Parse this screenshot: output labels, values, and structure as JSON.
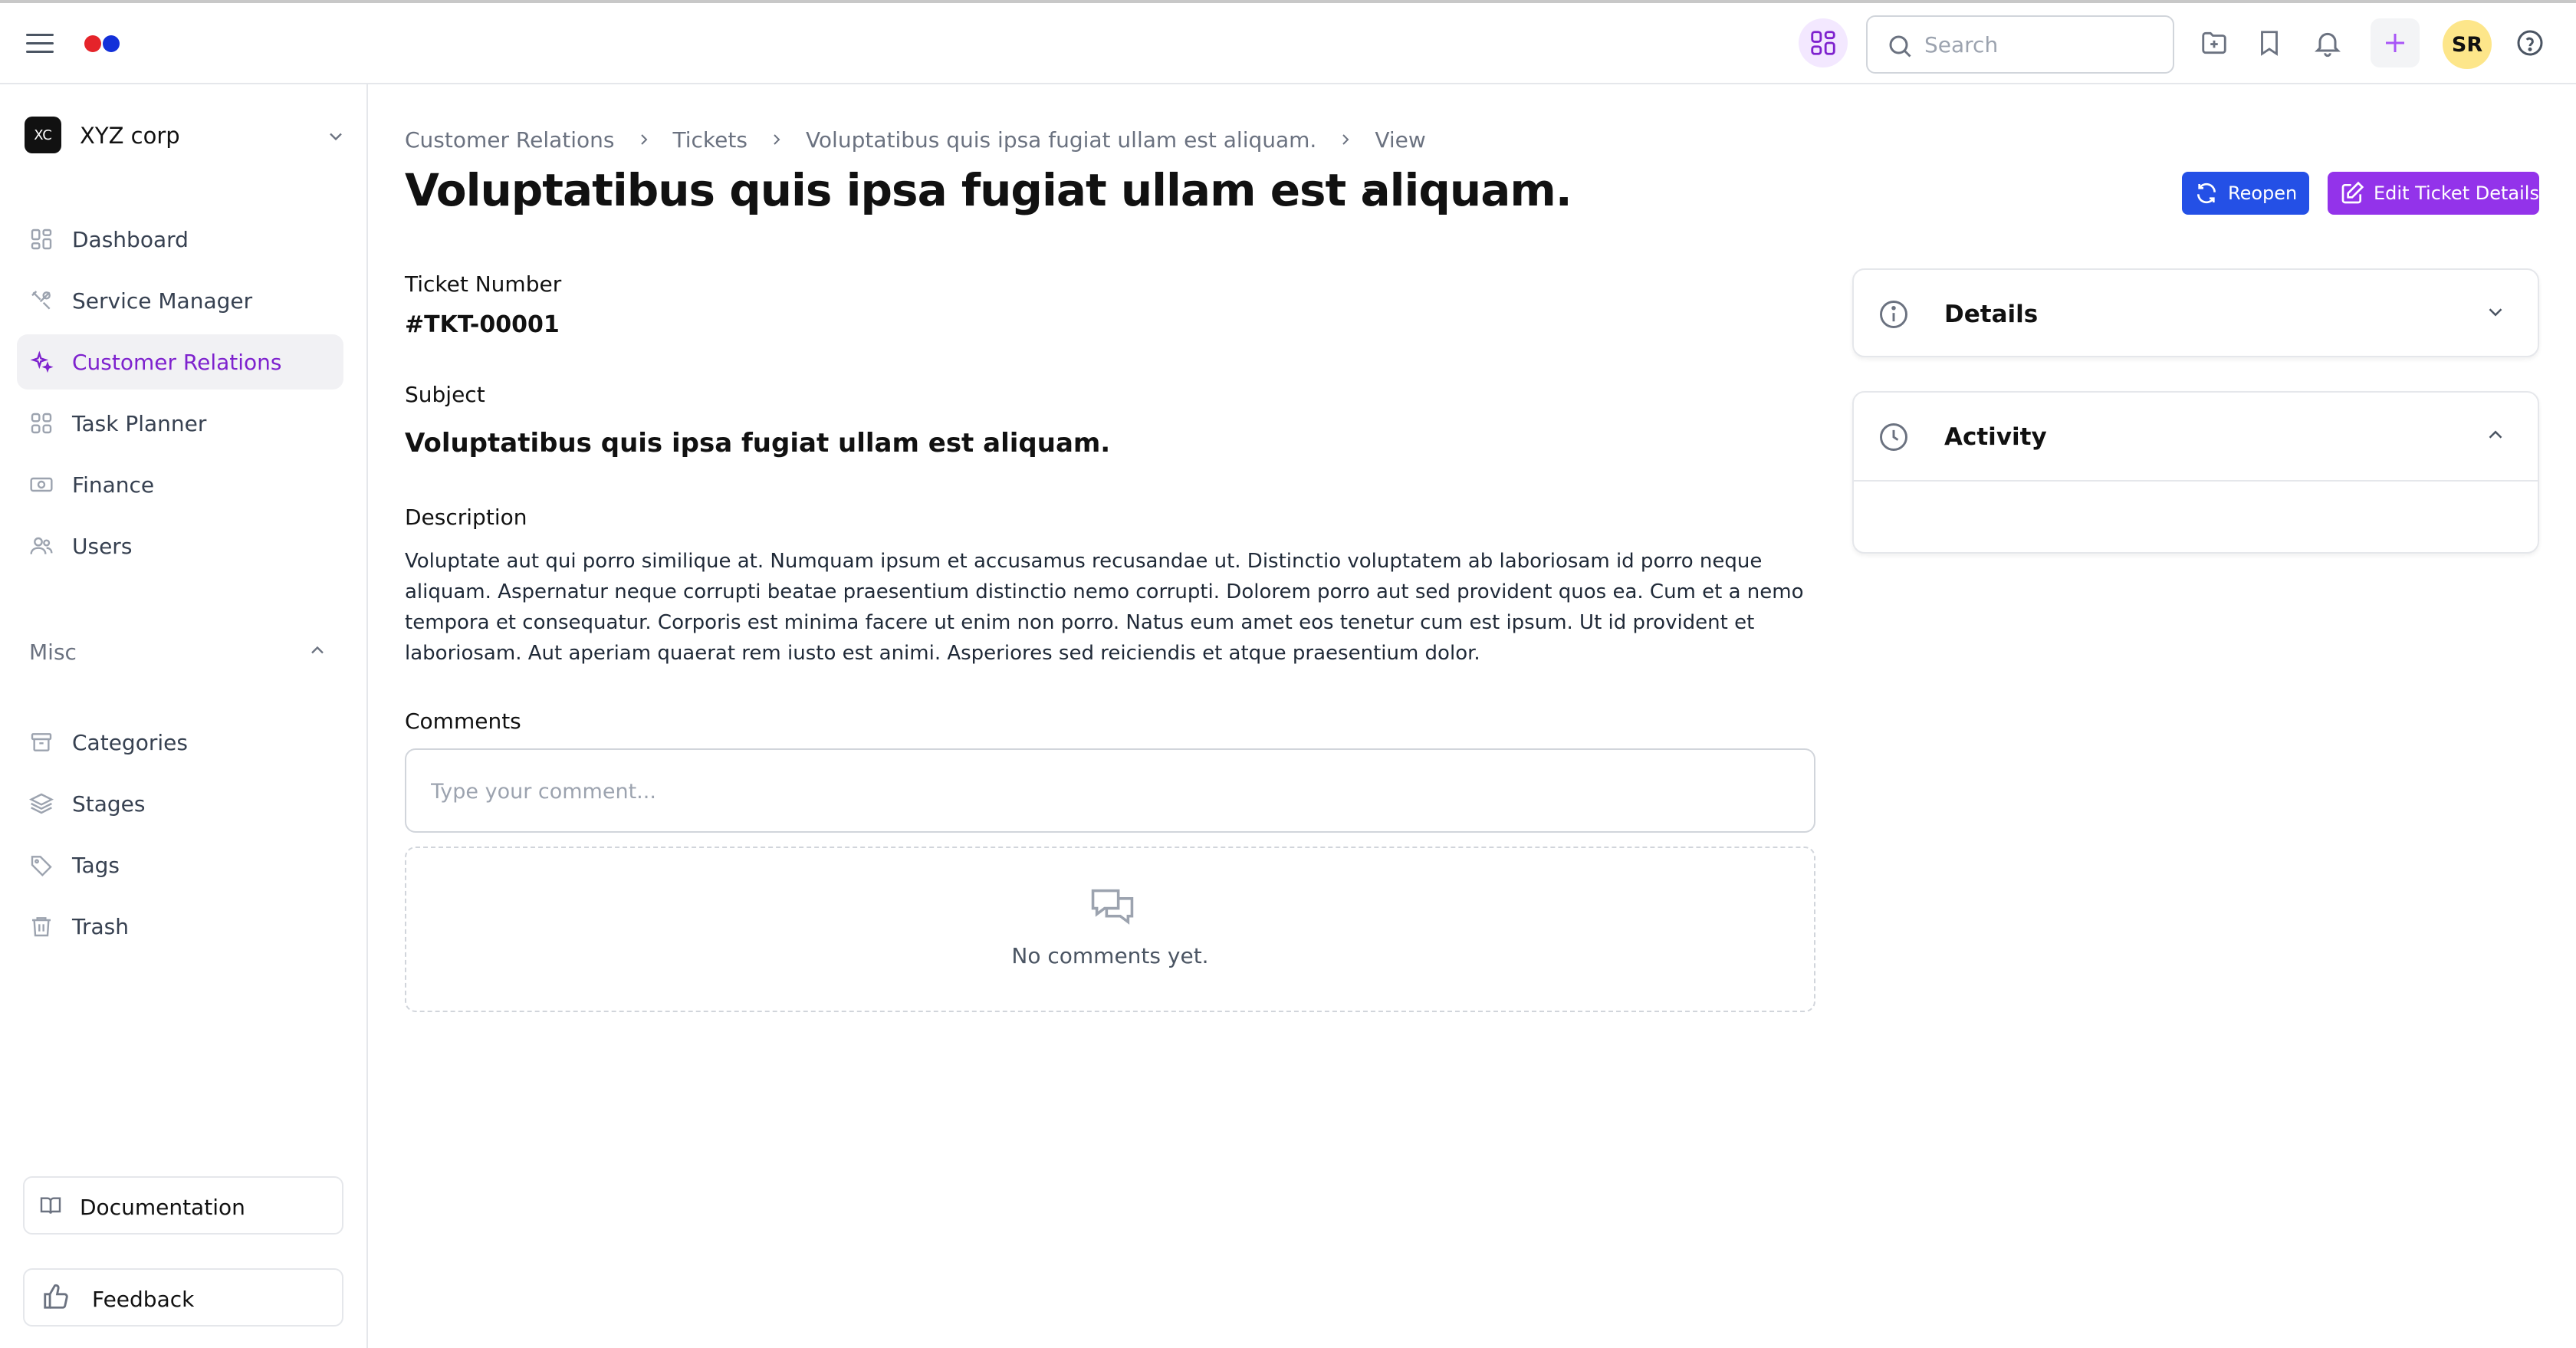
{
  "colors": {
    "accent_purple": "#7e22ce",
    "button_blue": "#2450e6",
    "button_purple": "#9333ea",
    "logo_red": "#e5242a",
    "logo_blue": "#1330d9",
    "avatar_bg": "#fde68a"
  },
  "topbar": {
    "search_placeholder": "Search",
    "avatar_initials": "SR",
    "icons": [
      "hamburger-icon",
      "apps-grid-icon",
      "search-icon",
      "folder-plus-icon",
      "bookmark-icon",
      "bell-icon",
      "plus-icon",
      "help-icon"
    ]
  },
  "sidebar": {
    "org": {
      "badge": "XC",
      "name": "XYZ corp"
    },
    "items": [
      {
        "label": "Dashboard",
        "icon": "dashboard-icon"
      },
      {
        "label": "Service Manager",
        "icon": "tools-icon"
      },
      {
        "label": "Customer Relations",
        "icon": "sparkles-icon",
        "active": true
      },
      {
        "label": "Task Planner",
        "icon": "grid-icon"
      },
      {
        "label": "Finance",
        "icon": "cash-icon"
      },
      {
        "label": "Users",
        "icon": "users-icon"
      }
    ],
    "misc_label": "Misc",
    "misc_items": [
      {
        "label": "Categories",
        "icon": "archive-icon"
      },
      {
        "label": "Stages",
        "icon": "layers-icon"
      },
      {
        "label": "Tags",
        "icon": "tag-icon"
      },
      {
        "label": "Trash",
        "icon": "trash-icon"
      }
    ],
    "documentation_label": "Documentation",
    "feedback_label": "Feedback"
  },
  "breadcrumb": [
    "Customer Relations",
    "Tickets",
    "Voluptatibus quis ipsa fugiat ullam est aliquam.",
    "View"
  ],
  "page": {
    "title": "Voluptatibus quis ipsa fugiat ullam est aliquam.",
    "reopen_label": "Reopen",
    "edit_label": "Edit Ticket Details"
  },
  "ticket": {
    "number_label": "Ticket Number",
    "number": "#TKT-00001",
    "subject_label": "Subject",
    "subject": "Voluptatibus quis ipsa fugiat ullam est aliquam.",
    "description_label": "Description",
    "description": "Voluptate aut qui porro similique at. Numquam ipsum et accusamus recusandae ut. Distinctio voluptatem ab laboriosam id porro neque aliquam. Aspernatur neque corrupti beatae praesentium distinctio nemo corrupti. Dolorem porro aut sed provident quos ea. Cum et a nemo tempora et consequatur. Corporis est minima facere ut enim non porro. Natus eum amet eos tenetur cum est ipsum. Ut id provident et laboriosam. Aut aperiam quaerat rem iusto est animi. Asperiores sed reiciendis et atque praesentium dolor.",
    "comments_label": "Comments",
    "comment_placeholder": "Type your comment...",
    "no_comments": "No comments yet."
  },
  "cards": {
    "details_title": "Details",
    "activity_title": "Activity"
  }
}
